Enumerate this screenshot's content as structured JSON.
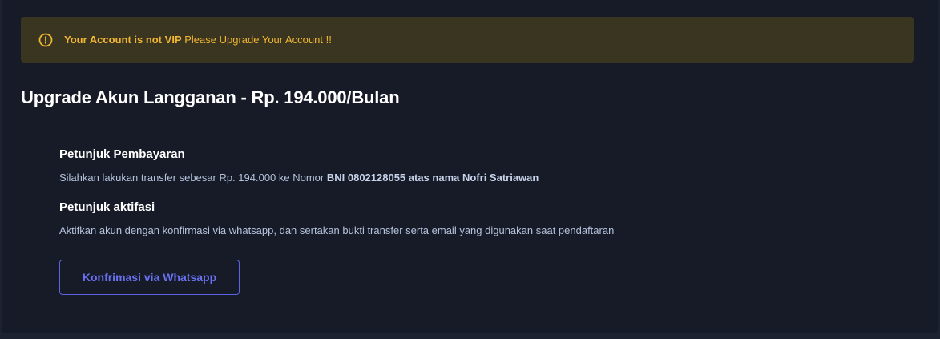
{
  "alert": {
    "icon": "alert-circle-icon",
    "bold_text": "Your Account is not VIP",
    "text": " Please Upgrade Your Account !!",
    "color": "#f2b632"
  },
  "title": "Upgrade Akun Langganan - Rp. 194.000/Bulan",
  "payment": {
    "heading": "Petunjuk Pembayaran",
    "text": "Silahkan lakukan transfer sebesar Rp. 194.000 ke Nomor ",
    "bold_text": "BNI 0802128055 atas nama Nofri Satriawan"
  },
  "activation": {
    "heading": "Petunjuk aktifasi",
    "text": "Aktifkan akun dengan konfirmasi via whatsapp, dan sertakan bukti transfer serta email yang digunakan saat pendaftaran"
  },
  "button": {
    "label": "Konfrimasi via Whatsapp",
    "color": "#5b63e6"
  }
}
